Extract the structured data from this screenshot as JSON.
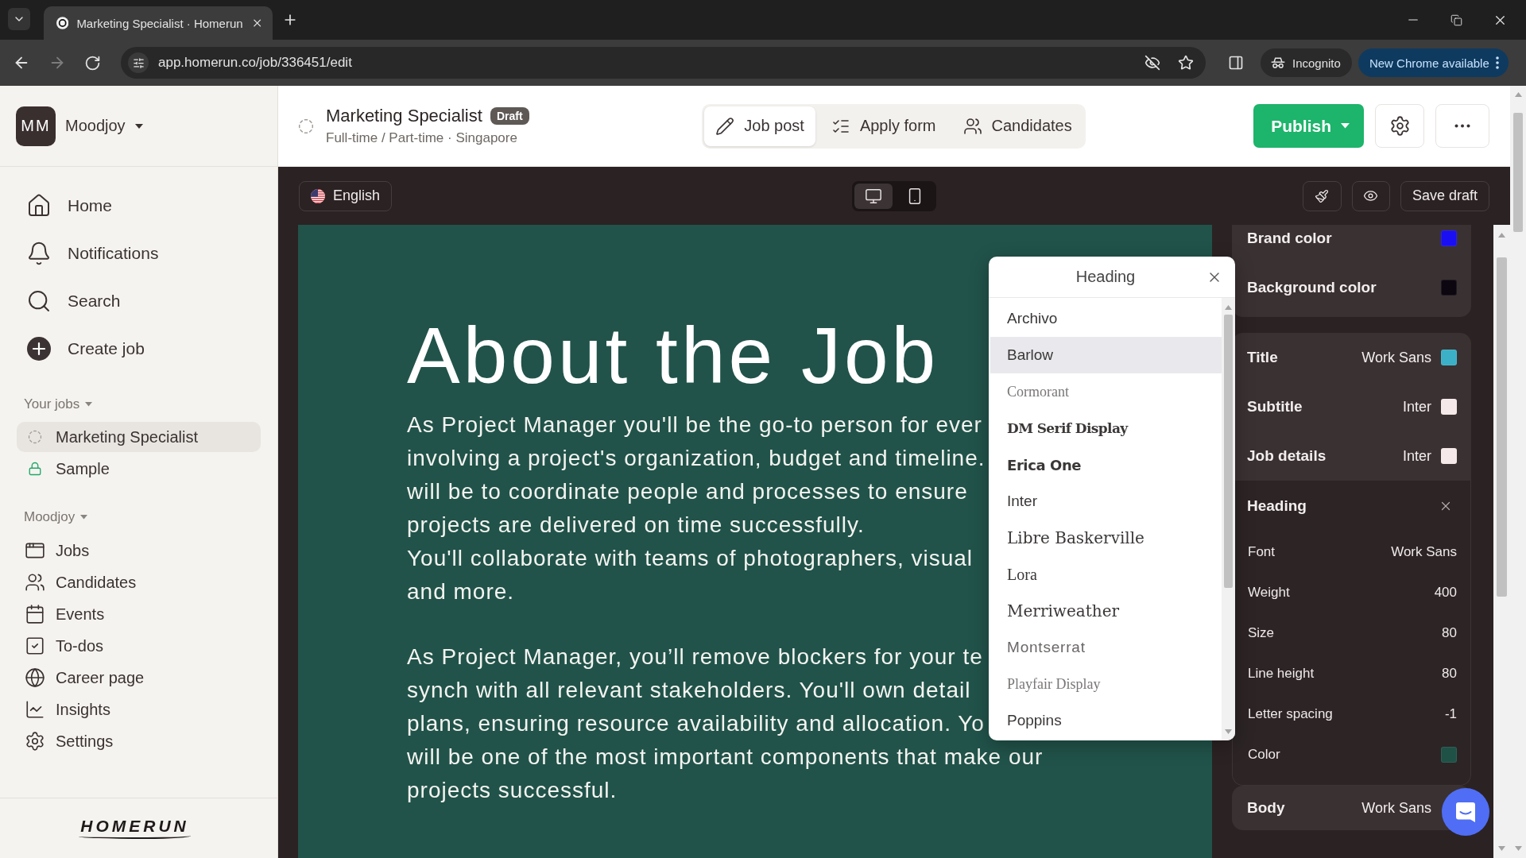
{
  "browser": {
    "tab_title": "Marketing Specialist · Homerun",
    "url": "app.homerun.co/job/336451/edit",
    "forward_disabled": true,
    "profile": "Incognito",
    "update": "New Chrome available"
  },
  "sidebar": {
    "workspace": {
      "initials": "MM",
      "name": "Moodjoy"
    },
    "nav": [
      {
        "label": "Home",
        "selected": false
      },
      {
        "label": "Notifications",
        "selected": false
      },
      {
        "label": "Search",
        "selected": false
      },
      {
        "label": "Create job",
        "selected": false
      }
    ],
    "jobs_heading": "Your jobs",
    "jobs": [
      {
        "label": "Marketing Specialist",
        "selected": true
      },
      {
        "label": "Sample",
        "selected": false
      }
    ],
    "org_heading": "Moodjoy",
    "org_nav": [
      {
        "label": "Jobs",
        "selected": false
      },
      {
        "label": "Candidates",
        "selected": false
      },
      {
        "label": "Events",
        "selected": false
      },
      {
        "label": "To-dos",
        "selected": false
      },
      {
        "label": "Career page",
        "selected": false
      },
      {
        "label": "Insights",
        "selected": false
      },
      {
        "label": "Settings",
        "selected": false
      }
    ],
    "logo": "HOMERUN"
  },
  "header": {
    "title": "Marketing Specialist",
    "badge": "Draft",
    "subtitle": "Full-time / Part-time · Singapore",
    "tabs": [
      {
        "label": "Job post",
        "selected": true
      },
      {
        "label": "Apply form",
        "selected": false
      },
      {
        "label": "Candidates",
        "selected": false
      }
    ],
    "publish": "Publish"
  },
  "toolbar": {
    "language": "English",
    "devices": [
      {
        "selected": true
      },
      {
        "selected": false
      }
    ],
    "save": "Save draft"
  },
  "preview": {
    "heading": "About the Job",
    "paragraphs": [
      {
        "lines": [
          "As Project Manager you'll be the go-to person for ever",
          "involving a project's organization, budget and timeline.",
          "will be to coordinate people and processes to ensure",
          "projects are delivered on time successfully.",
          "You'll collaborate with teams of photographers, visual",
          "and more."
        ]
      },
      {
        "lines": [
          "As Project Manager, you’ll remove blockers for your te",
          "synch with all relevant stakeholders. You'll own detail",
          "plans, ensuring resource availability and allocation. Yo",
          "will be one of the most important components that make our",
          "projects successful."
        ]
      }
    ]
  },
  "font_picker": {
    "title": "Heading",
    "options": [
      {
        "label": "Archivo",
        "kind": "sans",
        "highlighted": false
      },
      {
        "label": "Barlow",
        "kind": "sans",
        "highlighted": true
      },
      {
        "label": "Cormorant",
        "kind": "serif-light",
        "highlighted": false
      },
      {
        "label": "DM Serif Display",
        "kind": "serif-bold",
        "highlighted": false
      },
      {
        "label": "Erica One",
        "kind": "heavy",
        "highlighted": false
      },
      {
        "label": "Inter",
        "kind": "sans",
        "highlighted": false
      },
      {
        "label": "Libre Baskerville",
        "kind": "serif-wide",
        "highlighted": false
      },
      {
        "label": "Lora",
        "kind": "serif",
        "highlighted": false
      },
      {
        "label": "Merriweather",
        "kind": "serif-wide",
        "highlighted": false
      },
      {
        "label": "Montserrat",
        "kind": "sans-light",
        "highlighted": false
      },
      {
        "label": "Playfair Display",
        "kind": "serif-light",
        "highlighted": false
      },
      {
        "label": "Poppins",
        "kind": "sans",
        "highlighted": false
      }
    ]
  },
  "style_panel": {
    "colors": [
      {
        "label": "Brand color",
        "color": "#1a0ef2"
      },
      {
        "label": "Background color",
        "color": "#0b0610"
      }
    ],
    "text_styles": [
      {
        "label": "Title",
        "font": "Work Sans",
        "color": "#3bb0c6"
      },
      {
        "label": "Subtitle",
        "font": "Inter",
        "color": "#f6e9e9"
      },
      {
        "label": "Job details",
        "font": "Inter",
        "color": "#f6e9e9"
      }
    ],
    "editor": {
      "title": "Heading",
      "settings": [
        {
          "kind": "value",
          "label": "Font",
          "value": "Work Sans"
        },
        {
          "kind": "value",
          "label": "Weight",
          "value": "400"
        },
        {
          "kind": "value",
          "label": "Size",
          "value": "80"
        },
        {
          "kind": "value",
          "label": "Line height",
          "value": "80"
        },
        {
          "kind": "value",
          "label": "Letter spacing",
          "value": "-1"
        },
        {
          "kind": "color",
          "label": "Color",
          "color": "#1f5147"
        }
      ]
    },
    "more_styles": [
      {
        "label": "Body",
        "font": "Work Sans"
      }
    ]
  }
}
